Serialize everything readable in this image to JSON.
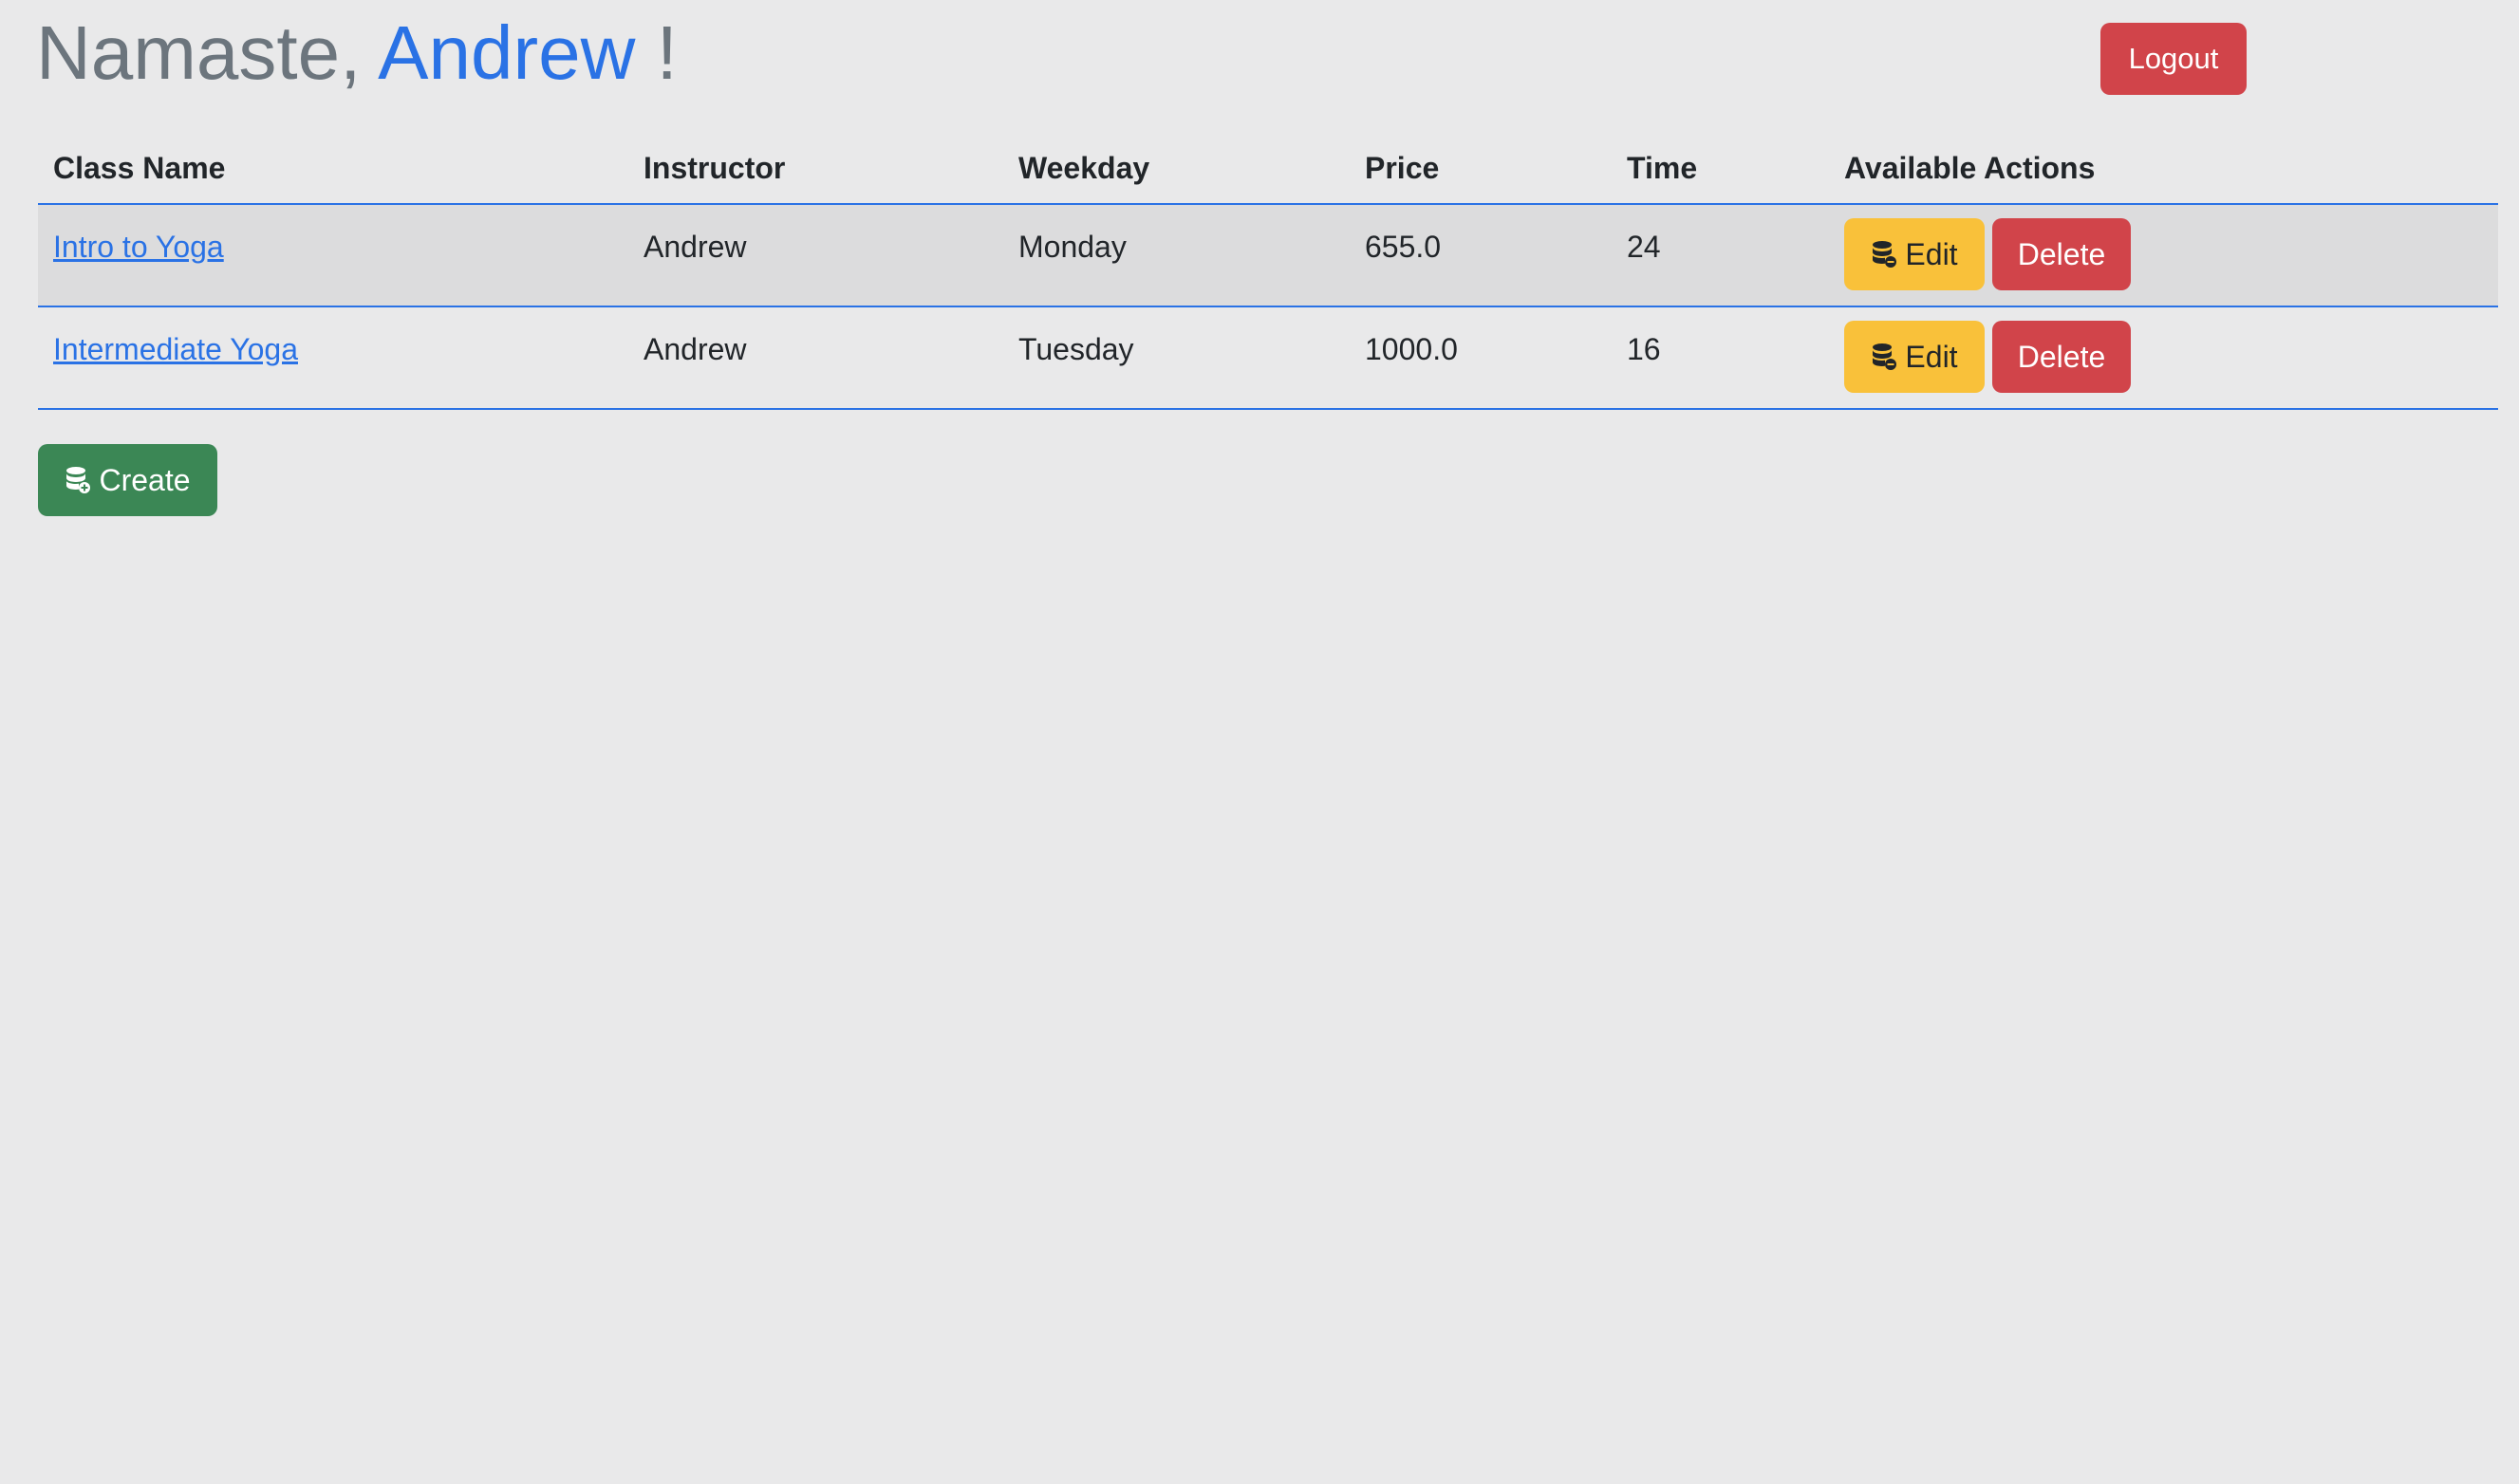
{
  "header": {
    "greeting_prefix": "Namaste, ",
    "user_name": "Andrew",
    "greeting_suffix": " !",
    "logout_label": "Logout"
  },
  "table": {
    "columns": [
      "Class Name",
      "Instructor",
      "Weekday",
      "Price",
      "Time",
      "Available Actions"
    ],
    "rows": [
      {
        "class_name": "Intro to Yoga",
        "instructor": "Andrew",
        "weekday": "Monday",
        "price": "655.0",
        "time": "24"
      },
      {
        "class_name": "Intermediate Yoga",
        "instructor": "Andrew",
        "weekday": "Tuesday",
        "price": "1000.0",
        "time": "16"
      }
    ],
    "edit_label": "Edit",
    "delete_label": "Delete"
  },
  "create_label": "Create",
  "icons": {
    "edit_icon": "database-edit-icon",
    "create_icon": "database-add-icon"
  },
  "colors": {
    "accent": "#2a72e5",
    "danger": "#d1444a",
    "warning": "#f9c13a",
    "success": "#3b8755"
  }
}
